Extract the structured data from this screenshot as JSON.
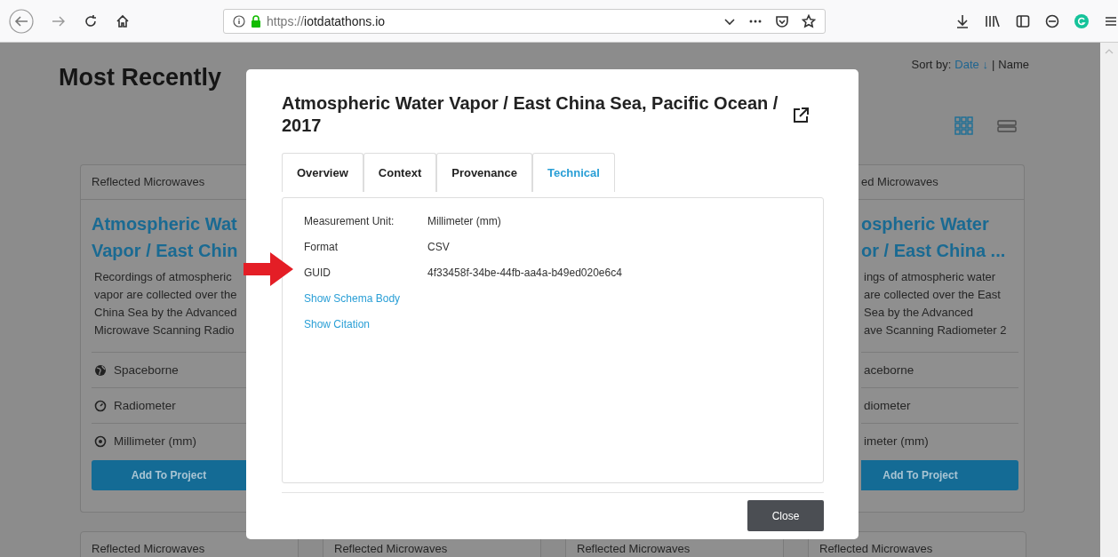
{
  "browser": {
    "url_scheme": "https://",
    "url_host": "iotdatathons.io"
  },
  "page": {
    "heading": "Most Recently",
    "sort": {
      "label": "Sort by:",
      "separator": "|",
      "options": [
        {
          "label": "Date ↓",
          "selected": true
        },
        {
          "label": "Name",
          "selected": false
        }
      ]
    },
    "views": [
      {
        "kind": "grid",
        "selected": true
      },
      {
        "kind": "list",
        "selected": false
      }
    ],
    "cards_top": [
      {
        "kind": "left",
        "header": "Reflected Microwaves",
        "title_lines": [
          "Atmospheric Wat",
          "Vapor / East Chin"
        ],
        "description_lines": [
          "Recordings of atmospheric",
          "vapor are collected over the",
          "China Sea by the Advanced",
          "Microwave Scanning Radio"
        ],
        "facts": [
          "Spaceborne",
          "Radiometer",
          "Millimeter (mm)"
        ],
        "button": "Add To Project"
      },
      {
        "kind": "right",
        "header": "ed Microwaves",
        "title_lines": [
          "ospheric Water",
          "or / East China ..."
        ],
        "description_lines": [
          "ings of atmospheric water",
          "are collected over the East",
          "Sea by the Advanced",
          "ave Scanning Radiometer 2"
        ],
        "facts": [
          "aceborne",
          "diometer",
          "imeter (mm)"
        ],
        "button": "Add To Project"
      }
    ],
    "cards_bottom": [
      {
        "header": "Reflected Microwaves"
      },
      {
        "header": "Reflected Microwaves"
      },
      {
        "header": "Reflected Microwaves"
      },
      {
        "header": "Reflected Microwaves"
      }
    ]
  },
  "modal": {
    "title": "Atmospheric Water Vapor / East China Sea, Pacific Ocean / 2017",
    "tabs": [
      {
        "label": "Overview",
        "selected": false
      },
      {
        "label": "Context",
        "selected": false
      },
      {
        "label": "Provenance",
        "selected": false
      },
      {
        "label": "Technical",
        "selected": true
      }
    ],
    "rows": [
      {
        "kind": "field",
        "label": "Measurement Unit:",
        "value": "Millimeter (mm)"
      },
      {
        "kind": "field",
        "label": "Format",
        "value": "CSV"
      },
      {
        "kind": "field",
        "label": "GUID",
        "value": "4f33458f-34be-44fb-aa4a-b49ed020e6c4"
      },
      {
        "kind": "link",
        "label": "Show Schema Body"
      },
      {
        "kind": "link",
        "label": "Show Citation"
      }
    ],
    "close": "Close"
  }
}
